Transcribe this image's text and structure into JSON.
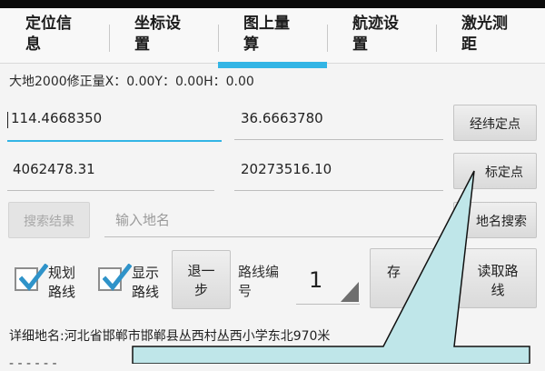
{
  "tabs": [
    {
      "line1": "定位信",
      "line2": "息"
    },
    {
      "line1": "坐标设",
      "line2": "置"
    },
    {
      "line1": "图上量",
      "line2": "算"
    },
    {
      "line1": "航迹设",
      "line2": "置"
    },
    {
      "line1": "激光测",
      "line2": "距"
    }
  ],
  "active_tab_index": 2,
  "correction_info": "大地2000修正量X：0.00Y：0.00H：0.00",
  "lng_lat": {
    "longitude": "114.4668350",
    "latitude": "36.6663780",
    "button": "经纬定点"
  },
  "plane_coords": {
    "x": "4062478.31",
    "y": "20273516.10",
    "button": "标定点"
  },
  "search": {
    "results_button": "搜索结果",
    "placeholder": "输入地名",
    "search_button": "地名搜索"
  },
  "route": {
    "plan_label_1": "规划",
    "plan_label_2": "路线",
    "plan_checked": true,
    "show_label_1": "显示",
    "show_label_2": "路线",
    "show_checked": true,
    "back_1": "退一",
    "back_2": "步",
    "number_label_1": "路线编",
    "number_label_2": "号",
    "number_value": "1",
    "save_label": "存",
    "read_1": "读取路",
    "read_2": "线"
  },
  "address_line": "详细地名:河北省邯郸市邯郸县丛西村丛西小学东北970米",
  "colors": {
    "accent": "#33b5e5",
    "callout_fill": "#bfe6e9",
    "checkbox_check": "#2f93c9"
  }
}
